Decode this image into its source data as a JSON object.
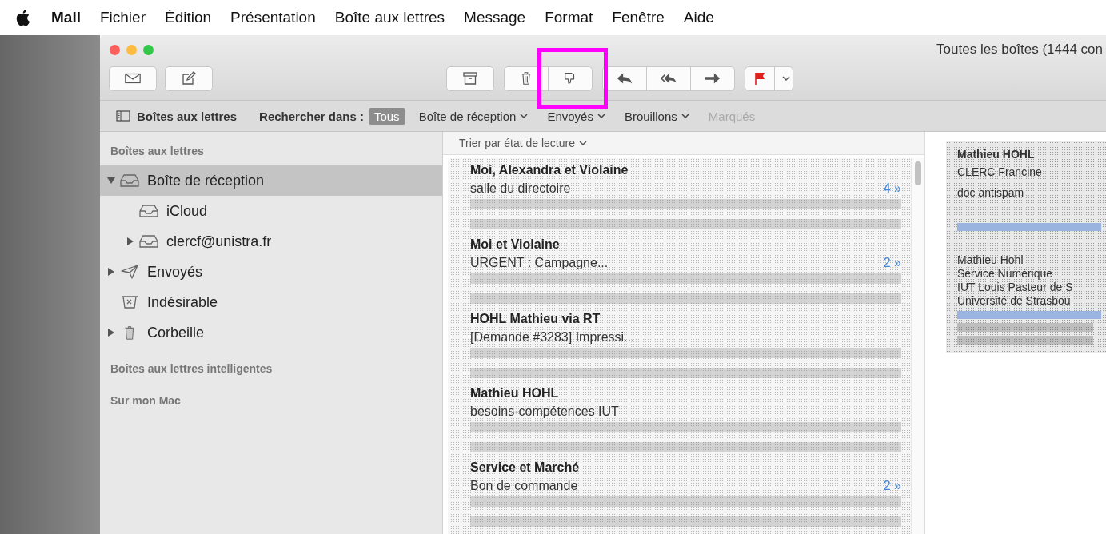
{
  "menubar": {
    "app": "Mail",
    "items": [
      "Fichier",
      "Édition",
      "Présentation",
      "Boîte aux lettres",
      "Message",
      "Format",
      "Fenêtre",
      "Aide"
    ]
  },
  "window": {
    "title": "Toutes les boîtes (1444 con"
  },
  "scope_bar": {
    "sidebar_toggle": "Boîtes aux lettres",
    "search_label": "Rechercher dans :",
    "scopes": [
      {
        "label": "Tous",
        "selected": true,
        "disabled": false,
        "menu": false
      },
      {
        "label": "Boîte de réception",
        "selected": false,
        "disabled": false,
        "menu": true
      },
      {
        "label": "Envoyés",
        "selected": false,
        "disabled": false,
        "menu": true
      },
      {
        "label": "Brouillons",
        "selected": false,
        "disabled": false,
        "menu": true
      },
      {
        "label": "Marqués",
        "selected": false,
        "disabled": true,
        "menu": false
      }
    ]
  },
  "sidebar": {
    "sections": [
      {
        "heading": "Boîtes aux lettres",
        "items": [
          {
            "label": "Boîte de réception",
            "kind": "inbox",
            "selected": true,
            "expanded": true,
            "children": [
              {
                "label": "iCloud",
                "kind": "inbox",
                "selected": false
              },
              {
                "label": "clercf@unistra.fr",
                "kind": "inbox",
                "selected": false,
                "expanded": false
              }
            ]
          },
          {
            "label": "Envoyés",
            "kind": "sent",
            "selected": false,
            "expanded": false
          },
          {
            "label": "Indésirable",
            "kind": "junk",
            "selected": false
          },
          {
            "label": "Corbeille",
            "kind": "trash",
            "selected": false,
            "expanded": false
          }
        ]
      },
      {
        "heading": "Boîtes aux lettres intelligentes"
      },
      {
        "heading": "Sur mon Mac"
      }
    ]
  },
  "message_list": {
    "sort": "Trier par état de lecture",
    "messages": [
      {
        "sender": "Moi, Alexandra et Violaine",
        "subject": "salle du directoire",
        "thread_count": "4 »"
      },
      {
        "sender": "Moi et Violaine",
        "subject": "URGENT : Campagne...",
        "thread_count": "2 »"
      },
      {
        "sender": "HOHL Mathieu via RT",
        "subject": "[Demande #3283] Impressi..."
      },
      {
        "sender": "Mathieu HOHL",
        "subject": "besoins-compétences IUT"
      },
      {
        "sender": "Service et Marché",
        "subject": "Bon de commande",
        "thread_count": "2 »"
      }
    ]
  },
  "preview": {
    "from": "Mathieu HOHL",
    "to": "CLERC Francine",
    "subject": "doc antispam",
    "signature": [
      "Mathieu Hohl",
      "Service Numérique",
      "IUT Louis Pasteur de S",
      "Université de Strasbou"
    ]
  }
}
